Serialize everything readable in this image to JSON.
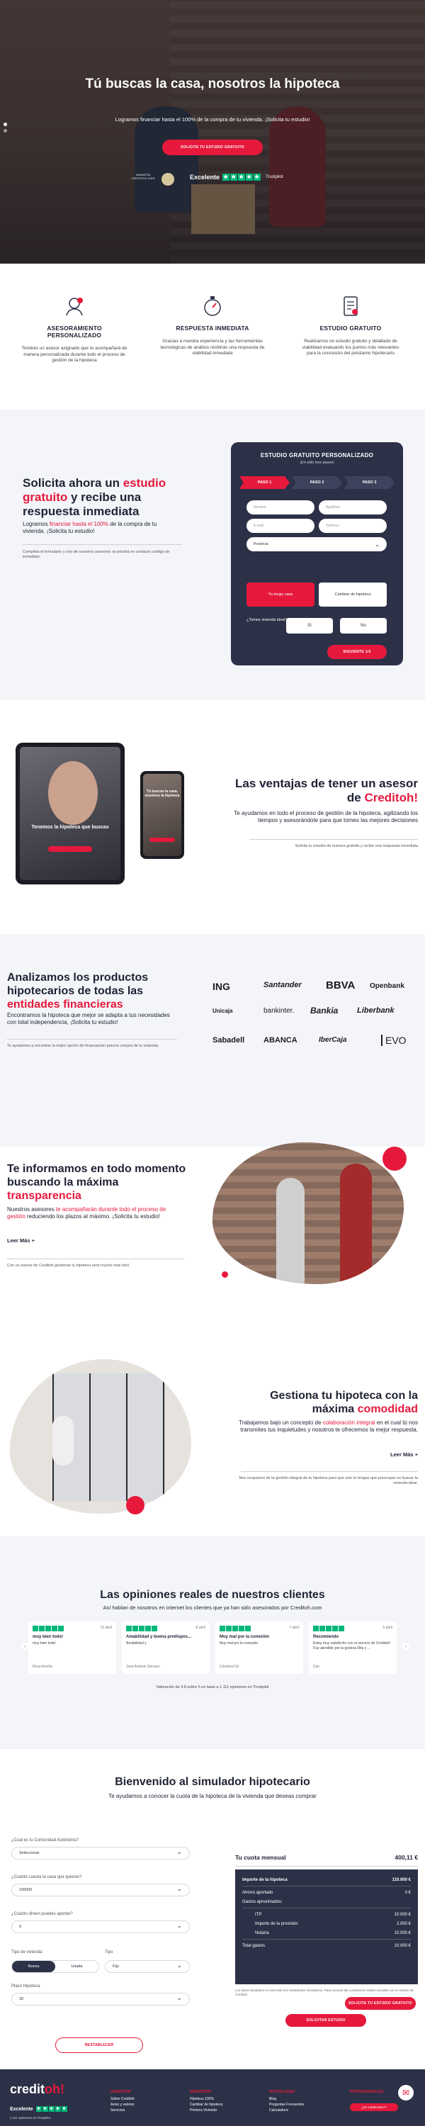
{
  "hero": {
    "title": "Tú buscas la casa, nosotros la hipoteca",
    "subtitle": "Logramos financiar hasta el 100% de la compra de tu vivienda. ¡Solicita tu estudio!",
    "cta": "SOLICITA TU ESTUDIO GRATUITO",
    "seal_text": "GARANTÍA CREDITOH! 100%",
    "trustpilot_label": "Excelente",
    "trustpilot_brand": "Trustpilot"
  },
  "features": [
    {
      "icon": "advisor-icon",
      "title": "ASESORAMIENTO PERSONALIZADO",
      "text": "Tendrás un asesor asignado que te acompañará de manera personalizada durante todo el proceso de gestión de la hipoteca"
    },
    {
      "icon": "stopwatch-icon",
      "title": "RESPUESTA INMEDIATA",
      "text": "Gracias a nuestra experiencia y las herramientas tecnológicas de análisis recibirás una respuesta de viabilidad inmediata"
    },
    {
      "icon": "document-icon",
      "title": "ESTUDIO GRATUITO",
      "text": "Realizamos un estudio gratuito y detallado de viabilidad evaluando los puntos más relevantes para la concesión del préstamo hipotecario"
    }
  ],
  "form_section": {
    "title_a": "Solicita ahora un ",
    "title_red": "estudio gratuito",
    "title_b": " y recibe una respuesta inmediata",
    "lead_a": "Logramos ",
    "lead_red": "financiar hasta el 100%",
    "lead_b": " de la compra de tu vivienda. ¡Solicita tu estudio!",
    "note": "Completa el formulario y uno de nuestros asesores se pondrá en contacto contigo de inmediato.",
    "card_title": "ESTUDIO GRATUITO PERSONALIZADO",
    "card_sub": "¡En sólo tres pasos!",
    "steps": [
      "PASO 1",
      "PASO 2",
      "PASO 3"
    ],
    "fields": {
      "name": "Nombre",
      "surname": "Apellidos",
      "email": "E-mail",
      "phone": "Teléfono",
      "province": "Provincia"
    },
    "options": [
      "Ya tengo casa",
      "Cambiar de hipoteca"
    ],
    "question": "¿Tienes vivienda ideal?",
    "yes": "Sí",
    "no": "No",
    "next": "SIGUIENTE 1/3"
  },
  "ventajas": {
    "tablet_title": "Tenemos la hipoteca que buscas",
    "phone_title": "Tú buscas la casa, nosotros la hipoteca",
    "title_a": "Las ventajas de tener un asesor de ",
    "title_red": "Creditoh!",
    "lead": "Te ayudamos en todo el proceso de gestión de la hipoteca, agilizando los tiempos y asesorándote para que tomes las mejores decisiones",
    "note": "Solicita tu estudio de manera gratuita y recibe una respuesta inmediata"
  },
  "banks": {
    "title_a": "Analizamos los productos hipotecarios de todas las ",
    "title_red": "entidades financieras",
    "lead": "Encontramos la hipoteca que mejor se adapta a tus necesidades con total independencia, ¡Solicita tu estudio!",
    "note": "Te ayudamos a encontrar la mejor opción de financiación para la compra de tu vivienda.",
    "logos": [
      "ING",
      "Santander",
      "BBVA",
      "Openbank",
      "Unicaja",
      "bankinter.",
      "Bankia",
      "Liberbank",
      "Sabadell",
      "ABANCA",
      "IberCaja",
      "EVO"
    ]
  },
  "transparencia": {
    "title_a": "Te informamos en todo momento buscando la máxima ",
    "title_red": "transparencia",
    "lead_a": "Nuestros asesores ",
    "lead_red": "te acompañarán durante todo el proceso de gestión",
    "lead_b": " reduciendo los plazos al máximo. ¡Solicita tu estudio!",
    "more": "Leer Más +",
    "note": "Con un asesor de Creditoh gestionar tu hipoteca será mucho más fácil."
  },
  "comodidad": {
    "title_a": "Gestiona tu hipoteca con la máxima ",
    "title_red": "comodidad",
    "lead_a": "Trabajamos bajo un concepto de ",
    "lead_red": "colaboración integral",
    "lead_b": " en el cual tú nos transmites tus inquietudes y nosotros te ofrecemos la mejor respuesta.",
    "more": "Leer Más +",
    "note": "Nos ocupamos de la gestión integral de tu hipoteca para que solo te tengas que preocupar en buscar la vivienda ideal."
  },
  "opiniones": {
    "title": "Las opiniones reales de nuestros clientes",
    "subtitle": "Así hablan de nosotros en internet los clientes que ya han sido asesorados por Creditoh.com",
    "reviews": [
      {
        "date": "15 abril",
        "title": "muy bien todo!",
        "body": "muy bien todo!",
        "author": "Rosa Arreña"
      },
      {
        "date": "8 abril",
        "title": "Amabilidad y buena predispos...",
        "body": "Amabilidad y",
        "author": "José Antonio Serrano"
      },
      {
        "date": "7 abril",
        "title": "Muy mal por la conexión",
        "body": "Muy mal por la conexión",
        "author": "Cristobal Gil"
      },
      {
        "date": "6 abril",
        "title": "Recomiendo",
        "body": "Estoy muy satisfecho con el servicio de Creditoh! Fue atendido por la gestora Rita y ...",
        "author": "Dan"
      }
    ],
    "summary": "Valoración de 4,8 sobre 5 en base a 1.111 opiniones en Trustpilot"
  },
  "simulador": {
    "title": "Bienvenido al simulador hipotecario",
    "subtitle": "Te ayudamos a conocer la cuota de la hipoteca de la vivienda que deseas comprar",
    "q_region": "¿Cuál es tu Comunidad Autónoma?",
    "v_region": "Seleccionar",
    "q_price": "¿Cuánto cuesta la casa que quieres?",
    "v_price": "100000",
    "q_money": "¿Cuánto dinero puedes aportar?",
    "v_money": "0",
    "q_house": "Tipo de vivienda",
    "house_opts": [
      "Nueva",
      "Usada"
    ],
    "q_type": "Tipo",
    "v_type": "Fijo",
    "q_term": "Plazo Hipoteca",
    "v_term": "30",
    "reset": "RESTABLECER",
    "cuota_label": "Tu cuota mensual",
    "cuota_value": "400,11 €",
    "rows": [
      {
        "l": "Importe de la hipoteca",
        "v": "110.000 €",
        "bold": true
      },
      {
        "l": "Ahorro aportado",
        "v": "0 €",
        "bold": false
      },
      {
        "l": "Gastos aproximados:",
        "v": "",
        "bold": false
      },
      {
        "l": "ITP",
        "v": "10.000 €",
        "bold": false,
        "ind": true
      },
      {
        "l": "Importe de la provisión",
        "v": "2.000 €",
        "bold": false,
        "ind": true
      },
      {
        "l": "Notaría",
        "v": "10.000 €",
        "bold": false,
        "ind": true
      },
      {
        "l": "Total gastos",
        "v": "10.000 €",
        "bold": false
      }
    ],
    "disclaimer": "Los datos simulados en esta web son meramente orientativos. Para conocer las condiciones reales consulte con un asesor de Creditoh.",
    "btn1": "SOLICITA TU ESTUDIO GRATUITO",
    "btn2": "SOLICITAR ESTUDIO"
  },
  "footer": {
    "brand_a": "credit",
    "brand_b": "oh!",
    "tp_label": "Excelente",
    "tp_reviews": "1.111 opiniones en Trustpilot",
    "cols": [
      {
        "h": "CREDITOH",
        "items": [
          "Sobre Creditoh",
          "Aviso y valores",
          "Servicios"
        ]
      },
      {
        "h": "SERVICIOS",
        "items": [
          "Hipoteca 100%",
          "Cambiar de hipoteca",
          "Primera Vivienda"
        ]
      },
      {
        "h": "ACTUALIDAD",
        "items": [
          "Blog",
          "Preguntas Frecuentes",
          "Calculadora"
        ]
      },
      {
        "h": "PROFESIONALES",
        "items": [
          "Colaboradores"
        ]
      }
    ],
    "chip": "¿Es colaborador?",
    "mail_icon": "mail-icon"
  }
}
